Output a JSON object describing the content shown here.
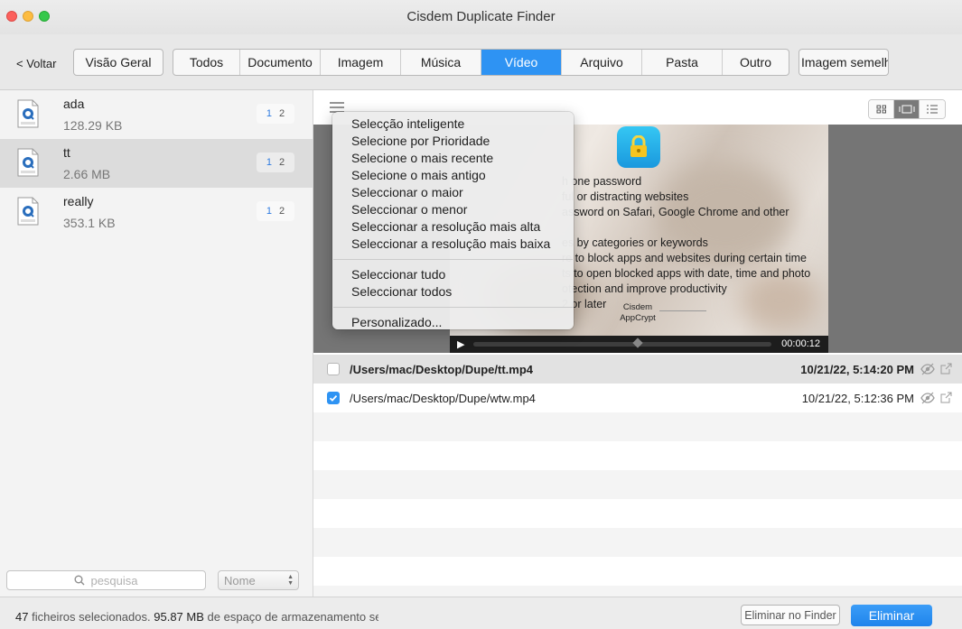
{
  "window": {
    "title": "Cisdem Duplicate Finder"
  },
  "toolbar": {
    "back_label": "< Voltar",
    "overview_label": "Visão Geral",
    "tabs": [
      {
        "label": "Todos"
      },
      {
        "label": "Documento"
      },
      {
        "label": "Imagem"
      },
      {
        "label": "Música"
      },
      {
        "label": "Vídeo",
        "active": true
      },
      {
        "label": "Arquivo"
      },
      {
        "label": "Pasta"
      },
      {
        "label": "Outro"
      }
    ],
    "similar_label": "Imagem semelhante"
  },
  "sidebar": {
    "files": [
      {
        "name": "ada",
        "size": "128.29 KB",
        "selected_count": "1",
        "total_count": "2"
      },
      {
        "name": "tt",
        "size": "2.66 MB",
        "selected_count": "1",
        "total_count": "2"
      },
      {
        "name": "really",
        "size": "353.1 KB",
        "selected_count": "1",
        "total_count": "2"
      }
    ],
    "search_placeholder": "pesquisa",
    "sort_value": "Nome"
  },
  "preview": {
    "lines": [
      "h one password",
      "ful or distracting websites",
      "assword on Safari, Google Chrome and other",
      "",
      "es by categories or keywords",
      "re to block apps and websites during certain time",
      "ts to open blocked apps with date, time and photo",
      "otection and improve productivity",
      "2 or later"
    ],
    "brand_name": "Cisdem",
    "brand_product": "AppCrypt",
    "play_glyph": "▶",
    "time": "00:00:12",
    "progress_fraction": 0.55
  },
  "files_list": [
    {
      "path": "/Users/mac/Desktop/Dupe/tt.mp4",
      "date": "10/21/22, 5:14:20 PM",
      "checked": false
    },
    {
      "path": "/Users/mac/Desktop/Dupe/wtw.mp4",
      "date": "10/21/22, 5:12:36 PM",
      "checked": true
    }
  ],
  "menu": {
    "group1": [
      "Selecção inteligente",
      "Selecione por Prioridade",
      "Selecione o mais recente",
      "Selecione o mais antigo",
      "Seleccionar o maior",
      "Seleccionar o menor",
      "Seleccionar a resolução mais alta",
      "Seleccionar a resolução mais baixa"
    ],
    "group2": [
      "Seleccionar tudo",
      "Seleccionar todos"
    ],
    "group3": [
      "Personalizado..."
    ]
  },
  "footer": {
    "selected_count": "47",
    "selected_text": "ficheiros selecionados.",
    "size": "95.87 MB",
    "size_text": "de espaço de armazenamento será libertado.",
    "finder_label": "Eliminar no Finder",
    "delete_label": "Eliminar"
  },
  "colors": {
    "accent": "#2e93f3"
  }
}
